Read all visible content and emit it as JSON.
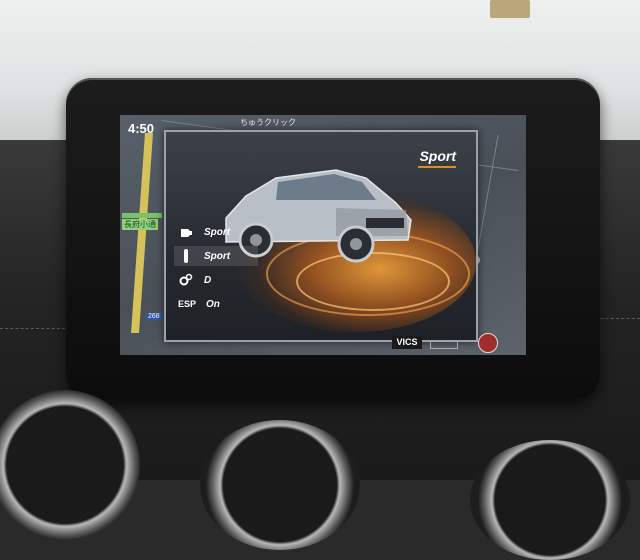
{
  "clock": "4:50",
  "map": {
    "label_top": "ちゅうクリック",
    "label_left": "長府小通",
    "route_label": "268"
  },
  "panel": {
    "title": "Sport",
    "rows": [
      {
        "icon": "engine-icon",
        "label": "",
        "value": "Sport"
      },
      {
        "icon": "suspension-icon",
        "label": "",
        "value": "Sport"
      },
      {
        "icon": "transmission-gears-icon",
        "label": "",
        "value": "D"
      },
      {
        "icon": "esp-icon",
        "label": "ESP",
        "value": "On"
      }
    ]
  },
  "status": {
    "vics": "VICS"
  },
  "colors": {
    "accent": "#e58a1e",
    "panel_border": "#9aa1a8"
  }
}
